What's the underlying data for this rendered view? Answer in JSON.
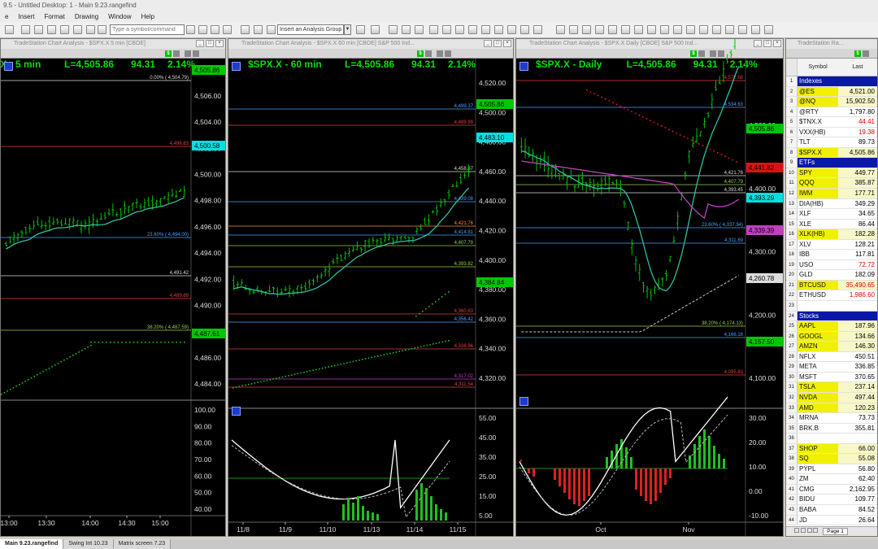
{
  "app": {
    "title": "9.5 - Untitled Desktop: 1 - Main 9.23.rangefind",
    "menu": [
      "e",
      "Insert",
      "Format",
      "Drawing",
      "Window",
      "Help"
    ],
    "symbol_placeholder": "Type a symbol/command",
    "analysis_group": "Insert an Analysis Group"
  },
  "charts": [
    {
      "window_title": "TradeStation Chart Analysis - $SPX.X 5 min [CBOE]",
      "title": ".X - 5 min",
      "last": "L=4,505.86",
      "change": "94.31",
      "pct": "2.14%",
      "price_axis": [
        "4,506.00",
        "4,504.00",
        "4,502.00",
        "4,500.00",
        "4,498.00",
        "4,496.00",
        "4,494.00",
        "4,492.00",
        "4,490.00",
        "4,488.00",
        "4,486.00",
        "4,484.00"
      ],
      "price_tags": [
        {
          "text": "4,505.86",
          "bg": "#00c800",
          "fg": "#000000"
        },
        {
          "text": "4,500.58",
          "bg": "#00e0e0",
          "fg": "#000000"
        },
        {
          "text": "4,487.61",
          "bg": "#00c800",
          "fg": "#000000"
        }
      ],
      "level_labels": [
        {
          "text": "0.00% ( 4,504.79)",
          "color": "#dddddd"
        },
        {
          "text": "4,496.83",
          "color": "#e04040"
        },
        {
          "text": "23.60% ( 4,494.00)",
          "color": "#4aa0ff"
        },
        {
          "text": "4,491.42",
          "color": "#dddddd"
        },
        {
          "text": "4,489.89",
          "color": "#e04040"
        },
        {
          "text": "38.20% ( 4,487.59)",
          "color": "#9ad050"
        }
      ],
      "osc_axis": [
        "100.00",
        "90.00",
        "80.00",
        "70.00",
        "60.00",
        "50.00",
        "40.00"
      ],
      "time_axis": [
        "13:00",
        "13:30",
        "14:00",
        "14:30",
        "15:00"
      ]
    },
    {
      "window_title": "TradeStation Chart Analysis - $SPX.X 60 min [CBOE] S&P 500 Ind...",
      "title": "$SPX.X - 60 min",
      "last": "L=4,505.86",
      "change": "94.31",
      "pct": "2.14%",
      "price_axis": [
        "4,520.00",
        "4,500.00",
        "4,480.00",
        "4,460.00",
        "4,440.00",
        "4,420.00",
        "4,400.00",
        "4,380.00",
        "4,360.00",
        "4,340.00",
        "4,320.00"
      ],
      "price_tags": [
        {
          "text": "4,505.86",
          "bg": "#00c800",
          "fg": "#000000"
        },
        {
          "text": "4,483.10",
          "bg": "#00e0e0",
          "fg": "#000000"
        },
        {
          "text": "4,384.84",
          "bg": "#00c800",
          "fg": "#000000"
        }
      ],
      "level_labels": [
        {
          "text": "4,499.37",
          "color": "#4aa0ff"
        },
        {
          "text": "4,489.99",
          "color": "#e04040"
        },
        {
          "text": "4,458.67",
          "color": "#dddddd"
        },
        {
          "text": "4,439.08",
          "color": "#4aa0ff"
        },
        {
          "text": "4,421.76",
          "color": "#ff8a3a"
        },
        {
          "text": "4,414.81",
          "color": "#4aa0ff"
        },
        {
          "text": "4,407.79",
          "color": "#9ad050"
        },
        {
          "text": "4,393.82",
          "color": "#9ad050"
        },
        {
          "text": "4,360.63",
          "color": "#e04040"
        },
        {
          "text": "4,356.42",
          "color": "#4aa0ff"
        },
        {
          "text": "4,338.96",
          "color": "#e04040"
        },
        {
          "text": "4,317.02",
          "color": "#c040c0"
        },
        {
          "text": "4,311.54",
          "color": "#e04040"
        }
      ],
      "osc_axis": [
        "55.00",
        "45.00",
        "35.00",
        "25.00",
        "15.00",
        "5.00"
      ],
      "time_axis": [
        "11/8",
        "11/9",
        "11/10",
        "11/13",
        "11/14",
        "11/15"
      ]
    },
    {
      "window_title": "TradeStation Chart Analysis - $SPX.X Daily [CBOE] S&P 500 Ind...",
      "title": "$SPX.X - Daily",
      "last": "L=4,505.86",
      "change": "94.31",
      "pct": "2.14%",
      "price_axis": [
        "4,500.00",
        "4,400.00",
        "4,300.00",
        "4,200.00",
        "4,100.00"
      ],
      "price_tags": [
        {
          "text": "4,505.86",
          "bg": "#00c800",
          "fg": "#000000"
        },
        {
          "text": "4,441.82",
          "bg": "#e01010",
          "fg": "#000000"
        },
        {
          "text": "4,393.29",
          "bg": "#00e0e0",
          "fg": "#000000"
        },
        {
          "text": "4,339.39",
          "bg": "#c040c0",
          "fg": "#000000"
        },
        {
          "text": "4,260.78",
          "bg": "#dddddd",
          "fg": "#000000"
        },
        {
          "text": "4,157.50",
          "bg": "#00c800",
          "fg": "#000000"
        }
      ],
      "level_labels": [
        {
          "text": "4,577.68",
          "color": "#e04040"
        },
        {
          "text": "4,534.63",
          "color": "#4aa0ff"
        },
        {
          "text": "4,421.76",
          "color": "#dddddd"
        },
        {
          "text": "4,407.79",
          "color": "#9ad050"
        },
        {
          "text": "4,393.45",
          "color": "#dddddd"
        },
        {
          "text": "23.60% ( 4,337.94)",
          "color": "#4aa0ff"
        },
        {
          "text": "4,311.69",
          "color": "#4aa0ff"
        },
        {
          "text": "38.20% ( 4,174.13)",
          "color": "#9ad050"
        },
        {
          "text": "4,166.16",
          "color": "#4aa0ff"
        },
        {
          "text": "4,095.83",
          "color": "#e04040"
        }
      ],
      "osc_axis": [
        "30.00",
        "20.00",
        "10.00",
        "0.00",
        "-10.00"
      ],
      "time_axis": [
        "Oct",
        "Nov"
      ]
    }
  ],
  "watchlist": {
    "window_title": "TradeStation Ra...",
    "col_symbol": "Symbol",
    "col_last": "Last",
    "rows": [
      {
        "n": "1",
        "symbol": "Indexes",
        "last": "",
        "header": true
      },
      {
        "n": "2",
        "symbol": "@ES",
        "last": "4,521.00",
        "symbol_bg": "#f0f000",
        "last_color": "#000000"
      },
      {
        "n": "3",
        "symbol": "@NQ",
        "last": "15,902.50",
        "symbol_bg": "#f0f000",
        "last_color": "#000000"
      },
      {
        "n": "4",
        "symbol": "@RTY",
        "last": "1,797.80",
        "symbol_bg": "",
        "last_color": "#000000"
      },
      {
        "n": "5",
        "symbol": "$TNX.X",
        "last": "44.41",
        "symbol_bg": "",
        "last_color": "#e00000"
      },
      {
        "n": "6",
        "symbol": "VXX(HB)",
        "last": "19.38",
        "symbol_bg": "",
        "last_color": "#e00000"
      },
      {
        "n": "7",
        "symbol": "TLT",
        "last": "89.73",
        "symbol_bg": "",
        "last_color": "#000000"
      },
      {
        "n": "8",
        "symbol": "$SPX.X",
        "last": "4,505.86",
        "symbol_bg": "#f0f000",
        "last_color": "#000000"
      },
      {
        "n": "9",
        "symbol": "ETFs",
        "last": "",
        "header": true
      },
      {
        "n": "10",
        "symbol": "SPY",
        "last": "449.77",
        "symbol_bg": "#f0f000",
        "last_color": "#000000"
      },
      {
        "n": "11",
        "symbol": "QQQ",
        "last": "385.87",
        "symbol_bg": "#f0f000",
        "last_color": "#000000"
      },
      {
        "n": "12",
        "symbol": "IWM",
        "last": "177.71",
        "symbol_bg": "#f0f000",
        "last_color": "#000000"
      },
      {
        "n": "13",
        "symbol": "DIA(HB)",
        "last": "349.29",
        "symbol_bg": "",
        "last_color": "#000000"
      },
      {
        "n": "14",
        "symbol": "XLF",
        "last": "34.65",
        "symbol_bg": "",
        "last_color": "#000000"
      },
      {
        "n": "15",
        "symbol": "XLE",
        "last": "86.44",
        "symbol_bg": "",
        "last_color": "#000000"
      },
      {
        "n": "16",
        "symbol": "XLK(HB)",
        "last": "182.28",
        "symbol_bg": "#f0f000",
        "last_color": "#000000"
      },
      {
        "n": "17",
        "symbol": "XLV",
        "last": "128.21",
        "symbol_bg": "",
        "last_color": "#000000"
      },
      {
        "n": "18",
        "symbol": "IBB",
        "last": "117.81",
        "symbol_bg": "",
        "last_color": "#000000"
      },
      {
        "n": "19",
        "symbol": "USO",
        "last": "72.72",
        "symbol_bg": "",
        "last_color": "#e00000"
      },
      {
        "n": "20",
        "symbol": "GLD",
        "last": "182.09",
        "symbol_bg": "",
        "last_color": "#000000"
      },
      {
        "n": "21",
        "symbol": "BTCUSD",
        "last": "35,490.65",
        "symbol_bg": "#f0f000",
        "last_color": "#e00000"
      },
      {
        "n": "22",
        "symbol": "ETHUSD",
        "last": "1,986.60",
        "symbol_bg": "",
        "last_color": "#e00000"
      },
      {
        "n": "23",
        "symbol": "",
        "last": "",
        "symbol_bg": "",
        "last_color": "#000000"
      },
      {
        "n": "24",
        "symbol": "Stocks",
        "last": "",
        "header": true
      },
      {
        "n": "25",
        "symbol": "AAPL",
        "last": "187.96",
        "symbol_bg": "#f0f000",
        "last_color": "#000000"
      },
      {
        "n": "26",
        "symbol": "GOOGL",
        "last": "134.66",
        "symbol_bg": "#f0f000",
        "last_color": "#000000"
      },
      {
        "n": "27",
        "symbol": "AMZN",
        "last": "146.30",
        "symbol_bg": "#f0f000",
        "last_color": "#000000"
      },
      {
        "n": "28",
        "symbol": "NFLX",
        "last": "450.51",
        "symbol_bg": "",
        "last_color": "#000000"
      },
      {
        "n": "29",
        "symbol": "META",
        "last": "336.85",
        "symbol_bg": "",
        "last_color": "#000000"
      },
      {
        "n": "30",
        "symbol": "MSFT",
        "last": "370.65",
        "symbol_bg": "",
        "last_color": "#000000"
      },
      {
        "n": "31",
        "symbol": "TSLA",
        "last": "237.14",
        "symbol_bg": "#f0f000",
        "last_color": "#000000"
      },
      {
        "n": "32",
        "symbol": "NVDA",
        "last": "497.44",
        "symbol_bg": "#f0f000",
        "last_color": "#000000"
      },
      {
        "n": "33",
        "symbol": "AMD",
        "last": "120.23",
        "symbol_bg": "#f0f000",
        "last_color": "#000000"
      },
      {
        "n": "34",
        "symbol": "MRNA",
        "last": "73.73",
        "symbol_bg": "",
        "last_color": "#000000"
      },
      {
        "n": "35",
        "symbol": "BRK.B",
        "last": "355.81",
        "symbol_bg": "",
        "last_color": "#000000"
      },
      {
        "n": "36",
        "symbol": "",
        "last": "",
        "symbol_bg": "",
        "last_color": "#000000"
      },
      {
        "n": "37",
        "symbol": "SHOP",
        "last": "66.00",
        "symbol_bg": "#f0f000",
        "last_color": "#000000"
      },
      {
        "n": "38",
        "symbol": "SQ",
        "last": "55.08",
        "symbol_bg": "#f0f000",
        "last_color": "#000000"
      },
      {
        "n": "39",
        "symbol": "PYPL",
        "last": "56.80",
        "symbol_bg": "",
        "last_color": "#000000"
      },
      {
        "n": "40",
        "symbol": "ZM",
        "last": "62.40",
        "symbol_bg": "",
        "last_color": "#000000"
      },
      {
        "n": "41",
        "symbol": "CMG",
        "last": "2,162.95",
        "symbol_bg": "",
        "last_color": "#000000"
      },
      {
        "n": "42",
        "symbol": "BIDU",
        "last": "109.77",
        "symbol_bg": "",
        "last_color": "#000000"
      },
      {
        "n": "43",
        "symbol": "BABA",
        "last": "84.52",
        "symbol_bg": "",
        "last_color": "#000000"
      },
      {
        "n": "44",
        "symbol": "JD",
        "last": "26.64",
        "symbol_bg": "",
        "last_color": "#000000"
      }
    ],
    "page_tab": "Page 1"
  },
  "tabs": [
    {
      "label": "Main 9.23.rangefind",
      "active": true
    },
    {
      "label": "Swing Int 10.23",
      "active": false
    },
    {
      "label": "Matrix screen 7.23",
      "active": false
    }
  ]
}
